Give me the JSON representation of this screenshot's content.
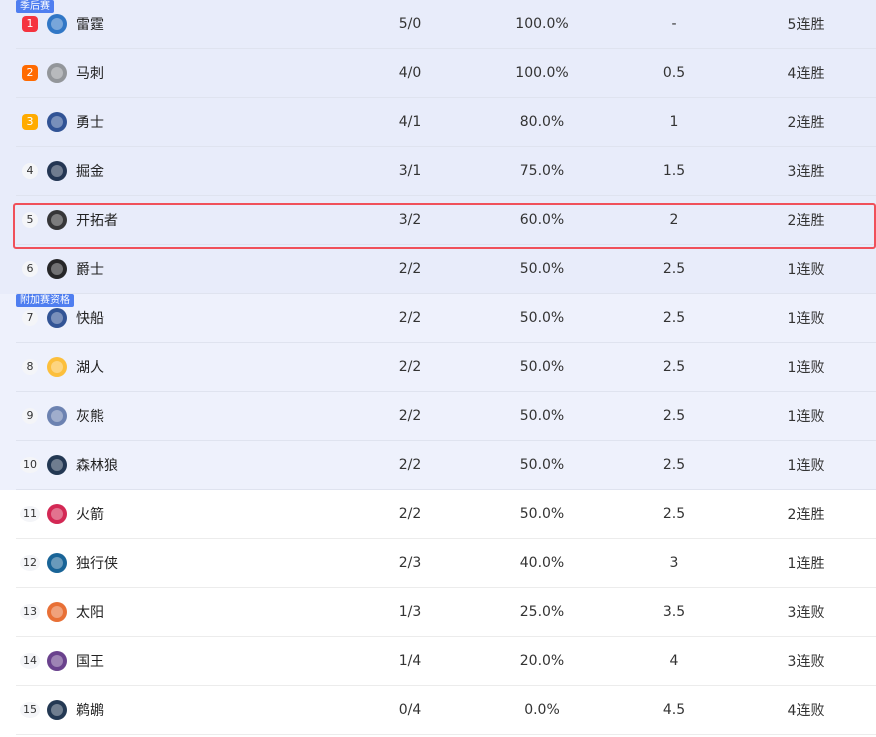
{
  "sections": [
    {
      "tag": "季后赛",
      "rows": [
        {
          "rank": "1",
          "name": "雷霆",
          "wl": "5/0",
          "pct": "100.0%",
          "gb": "-",
          "streak": "5连胜",
          "logo": "okc-logo",
          "color": "#1d6ac0"
        },
        {
          "rank": "2",
          "name": "马刺",
          "wl": "4/0",
          "pct": "100.0%",
          "gb": "0.5",
          "streak": "4连胜",
          "logo": "spurs-logo",
          "color": "#8a8d8f"
        },
        {
          "rank": "3",
          "name": "勇士",
          "wl": "4/1",
          "pct": "80.0%",
          "gb": "1",
          "streak": "2连胜",
          "logo": "warriors-logo",
          "color": "#1d428a"
        },
        {
          "rank": "4",
          "name": "掘金",
          "wl": "3/1",
          "pct": "75.0%",
          "gb": "1.5",
          "streak": "3连胜",
          "logo": "nuggets-logo",
          "color": "#0e2240"
        },
        {
          "rank": "5",
          "name": "开拓者",
          "wl": "3/2",
          "pct": "60.0%",
          "gb": "2",
          "streak": "2连胜",
          "logo": "blazers-logo",
          "color": "#222222"
        },
        {
          "rank": "6",
          "name": "爵士",
          "wl": "2/2",
          "pct": "50.0%",
          "gb": "2.5",
          "streak": "1连败",
          "logo": "jazz-logo",
          "color": "#111111"
        }
      ]
    },
    {
      "tag": "附加赛资格",
      "rows": [
        {
          "rank": "7",
          "name": "快船",
          "wl": "2/2",
          "pct": "50.0%",
          "gb": "2.5",
          "streak": "1连败",
          "logo": "clippers-logo",
          "color": "#1d428a"
        },
        {
          "rank": "8",
          "name": "湖人",
          "wl": "2/2",
          "pct": "50.0%",
          "gb": "2.5",
          "streak": "1连败",
          "logo": "lakers-logo",
          "color": "#fdb927"
        },
        {
          "rank": "9",
          "name": "灰熊",
          "wl": "2/2",
          "pct": "50.0%",
          "gb": "2.5",
          "streak": "1连败",
          "logo": "grizzlies-logo",
          "color": "#5d76a9"
        },
        {
          "rank": "10",
          "name": "森林狼",
          "wl": "2/2",
          "pct": "50.0%",
          "gb": "2.5",
          "streak": "1连败",
          "logo": "wolves-logo",
          "color": "#0c2340"
        }
      ]
    },
    {
      "tag": "",
      "rows": [
        {
          "rank": "11",
          "name": "火箭",
          "wl": "2/2",
          "pct": "50.0%",
          "gb": "2.5",
          "streak": "2连胜",
          "logo": "rockets-logo",
          "color": "#ce1141"
        },
        {
          "rank": "12",
          "name": "独行侠",
          "wl": "2/3",
          "pct": "40.0%",
          "gb": "3",
          "streak": "1连胜",
          "logo": "mavericks-logo",
          "color": "#00538c"
        },
        {
          "rank": "13",
          "name": "太阳",
          "wl": "1/3",
          "pct": "25.0%",
          "gb": "3.5",
          "streak": "3连败",
          "logo": "suns-logo",
          "color": "#e56020"
        },
        {
          "rank": "14",
          "name": "国王",
          "wl": "1/4",
          "pct": "20.0%",
          "gb": "4",
          "streak": "3连败",
          "logo": "kings-logo",
          "color": "#5a2d81"
        },
        {
          "rank": "15",
          "name": "鹈鹕",
          "wl": "0/4",
          "pct": "0.0%",
          "gb": "4.5",
          "streak": "4连败",
          "logo": "pelicans-logo",
          "color": "#0c2340"
        }
      ]
    }
  ],
  "highlight_rank": "5"
}
